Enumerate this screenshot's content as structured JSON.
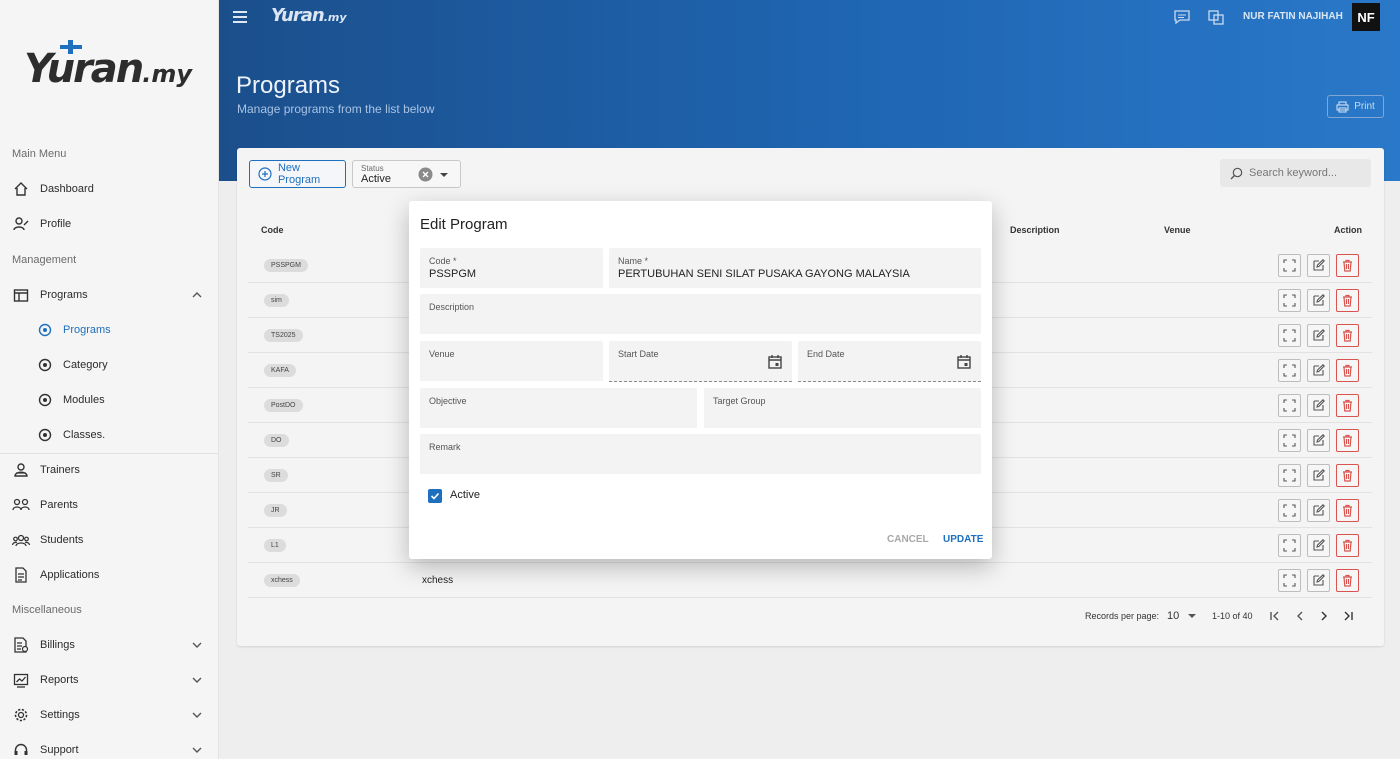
{
  "brand": {
    "logo": "Yuran",
    "logo_suffix": ".my"
  },
  "sidebar": {
    "sections": {
      "main": "Main Menu",
      "management": "Management",
      "misc": "Miscellaneous"
    },
    "items": [
      {
        "label": "Dashboard",
        "icon": "home-icon"
      },
      {
        "label": "Profile",
        "icon": "profile-icon"
      },
      {
        "label": "Programs",
        "icon": "programs-icon",
        "expanded": true
      },
      {
        "label": "Programs",
        "icon": "radio-icon",
        "active": true
      },
      {
        "label": "Category",
        "icon": "radio-icon"
      },
      {
        "label": "Modules",
        "icon": "radio-icon"
      },
      {
        "label": "Classes.",
        "icon": "radio-icon"
      },
      {
        "label": "Trainers",
        "icon": "trainers-icon"
      },
      {
        "label": "Parents",
        "icon": "parents-icon"
      },
      {
        "label": "Students",
        "icon": "students-icon"
      },
      {
        "label": "Applications",
        "icon": "applications-icon"
      },
      {
        "label": "Billings",
        "icon": "billings-icon"
      },
      {
        "label": "Reports",
        "icon": "reports-icon"
      },
      {
        "label": "Settings",
        "icon": "settings-icon"
      },
      {
        "label": "Support",
        "icon": "support-icon"
      }
    ]
  },
  "header": {
    "user_name": "NUR FATIN NAJIHAH",
    "avatar_initials": "NF",
    "title": "Programs",
    "subtitle": "Manage programs from the list below",
    "print_label": "Print"
  },
  "toolbar": {
    "new_program_label": "New Program",
    "status_caption": "Status",
    "status_value": "Active",
    "search_placeholder": "Search keyword..."
  },
  "table": {
    "columns": {
      "code": "Code",
      "description": "Description",
      "venue": "Venue",
      "action": "Action"
    },
    "rows": [
      {
        "code": "PSSPGM",
        "name": ""
      },
      {
        "code": "sim",
        "name": ""
      },
      {
        "code": "TS2025",
        "name": ""
      },
      {
        "code": "KAFA",
        "name": ""
      },
      {
        "code": "PostDO",
        "name": ""
      },
      {
        "code": "DO",
        "name": ""
      },
      {
        "code": "SR",
        "name": ""
      },
      {
        "code": "JR",
        "name": ""
      },
      {
        "code": "L1",
        "name": ""
      },
      {
        "code": "xchess",
        "name": "xchess"
      }
    ],
    "pagination": {
      "records_label": "Records per page:",
      "per_page": "10",
      "range": "1-10 of 40"
    }
  },
  "dialog": {
    "title": "Edit Program",
    "fields": {
      "code": {
        "label": "Code *",
        "value": "PSSPGM"
      },
      "name": {
        "label": "Name *",
        "value": "PERTUBUHAN SENI SILAT PUSAKA GAYONG MALAYSIA"
      },
      "description": {
        "label": "Description",
        "value": ""
      },
      "venue": {
        "label": "Venue",
        "value": ""
      },
      "start_date": {
        "label": "Start Date",
        "value": ""
      },
      "end_date": {
        "label": "End Date",
        "value": ""
      },
      "objective": {
        "label": "Objective",
        "value": ""
      },
      "target_group": {
        "label": "Target Group",
        "value": ""
      },
      "remark": {
        "label": "Remark",
        "value": ""
      }
    },
    "active_label": "Active",
    "active_checked": true,
    "cancel_label": "CANCEL",
    "update_label": "UPDATE"
  },
  "colors": {
    "accent": "#1f6fbf",
    "header": "#1f66b3",
    "danger": "#d9534f"
  }
}
